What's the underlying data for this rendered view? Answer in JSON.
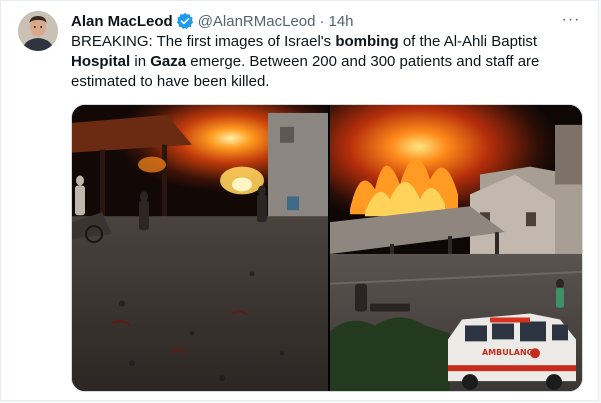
{
  "tweet": {
    "author_name": "Alan MacLeod",
    "handle": "@AlanRMacLeod",
    "separator": "·",
    "time": "14h",
    "more_label": "···",
    "text_segments": [
      {
        "t": "BREAKING: The first images of Israel's ",
        "b": false
      },
      {
        "t": "bombing",
        "b": true
      },
      {
        "t": " of the Al-Ahli Baptist ",
        "b": false
      },
      {
        "t": "Hospital",
        "b": true
      },
      {
        "t": " in ",
        "b": false
      },
      {
        "t": "Gaza",
        "b": true
      },
      {
        "t": " emerge. Between 200 and 300 patients and staff are estimated to have been killed.",
        "b": false
      }
    ],
    "ambulance_text": "AMBULANCE"
  },
  "colors": {
    "verified": "#1d9bf0",
    "text": "#0f1419",
    "secondary": "#536471"
  }
}
